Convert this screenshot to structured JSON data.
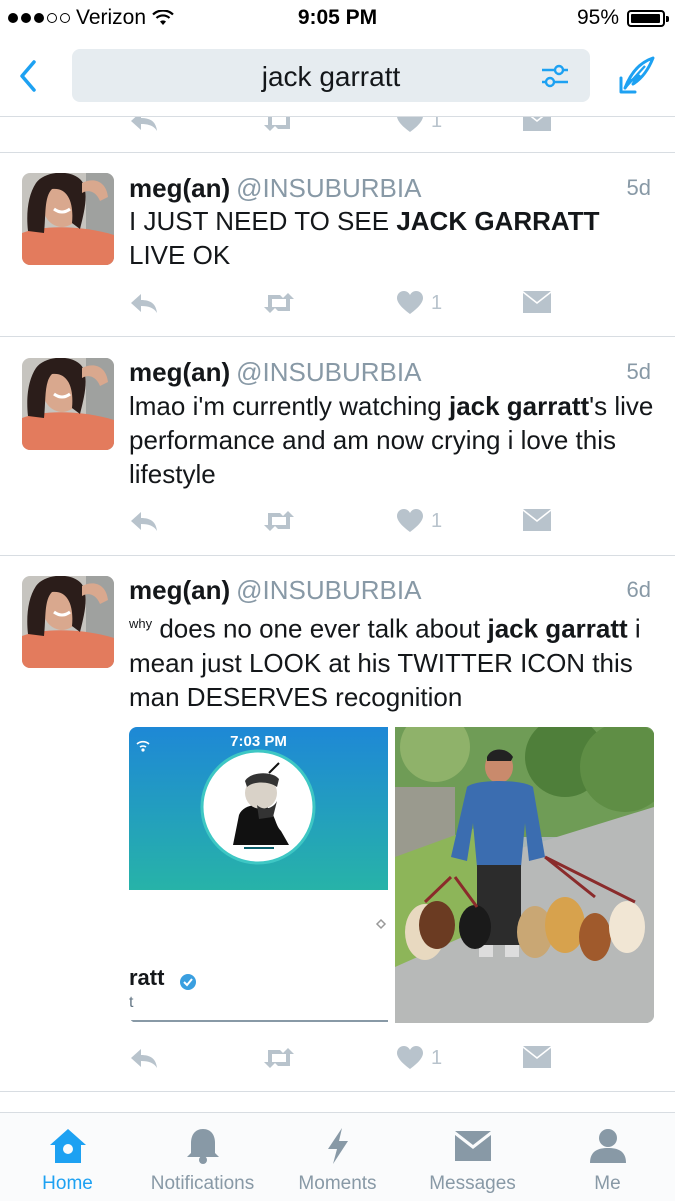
{
  "status": {
    "carrier": "Verizon",
    "time": "9:05 PM",
    "battery": "95%"
  },
  "search": {
    "query": "jack garratt"
  },
  "colors": {
    "accent": "#1da1f2",
    "muted": "#8899a6",
    "divider": "#d8dde2"
  },
  "tweets": [
    {
      "name": "meg(an)",
      "handle": "@INSUBURBIA",
      "date": "5d",
      "text_a": "I JUST NEED TO SEE ",
      "bold": "JACK GARRATT",
      "text_b": " LIVE OK",
      "likes": "1"
    },
    {
      "name": "meg(an)",
      "handle": "@INSUBURBIA",
      "date": "5d",
      "text_a": "lmao i'm currently watching ",
      "bold": "jack garratt",
      "text_b": "'s live performance and am now crying i love this lifestyle",
      "likes": "1"
    },
    {
      "name": "meg(an)",
      "handle": "@INSUBURBIA",
      "date": "6d",
      "sup": "why",
      "text_a": " does no one ever talk about ",
      "bold": "jack garratt",
      "text_b": " i mean just LOOK at his TWITTER ICON this man DESERVES recognition",
      "likes": "1",
      "media": {
        "phone_time": "7:03 PM",
        "profile_name_fragment": "ratt",
        "profile_sub_fragment": "t"
      }
    }
  ],
  "prev_tweet": {
    "likes": "1"
  },
  "tabs": [
    {
      "label": "Home",
      "icon": "home-icon",
      "active": true
    },
    {
      "label": "Notifications",
      "icon": "bell-icon"
    },
    {
      "label": "Moments",
      "icon": "lightning-icon"
    },
    {
      "label": "Messages",
      "icon": "envelope-icon"
    },
    {
      "label": "Me",
      "icon": "person-icon"
    }
  ]
}
